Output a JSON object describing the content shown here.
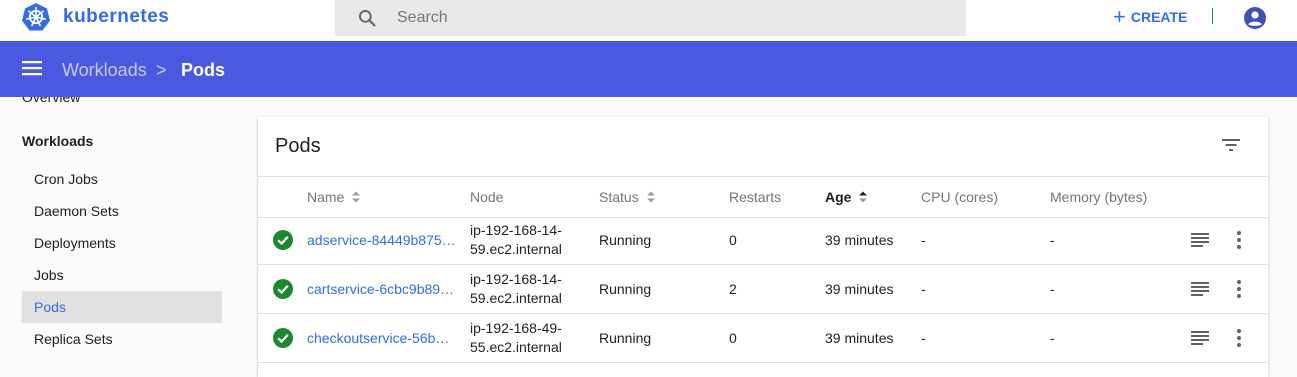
{
  "app": {
    "brand": "kubernetes",
    "accent": "#326de6",
    "nav_color": "#4a59e0"
  },
  "search": {
    "placeholder": "Search",
    "value": ""
  },
  "header": {
    "create_label": "CREATE"
  },
  "breadcrumb": {
    "parent": "Workloads",
    "separator": ">",
    "current": "Pods"
  },
  "sidebar": {
    "overview": "Overview",
    "section": "Workloads",
    "items": [
      {
        "label": "Cron Jobs"
      },
      {
        "label": "Daemon Sets"
      },
      {
        "label": "Deployments"
      },
      {
        "label": "Jobs"
      },
      {
        "label": "Pods",
        "active": true
      },
      {
        "label": "Replica Sets"
      }
    ]
  },
  "pods": {
    "title": "Pods",
    "columns": {
      "name": "Name",
      "node": "Node",
      "status": "Status",
      "restarts": "Restarts",
      "age": "Age",
      "cpu": "CPU (cores)",
      "memory": "Memory (bytes)"
    },
    "rows": [
      {
        "name": "adservice-84449b875…",
        "node": "ip-192-168-14-59.ec2.internal",
        "status": "Running",
        "restarts": "0",
        "age": "39 minutes",
        "cpu": "-",
        "memory": "-"
      },
      {
        "name": "cartservice-6cbc9b89…",
        "node": "ip-192-168-14-59.ec2.internal",
        "status": "Running",
        "restarts": "2",
        "age": "39 minutes",
        "cpu": "-",
        "memory": "-"
      },
      {
        "name": "checkoutservice-56b…",
        "node": "ip-192-168-49-55.ec2.internal",
        "status": "Running",
        "restarts": "0",
        "age": "39 minutes",
        "cpu": "-",
        "memory": "-"
      }
    ]
  },
  "icons": {
    "logo": "kubernetes-logo-icon",
    "search": "search-icon",
    "create": "plus-icon",
    "account": "account-circle-icon",
    "menu": "menu-icon",
    "filter": "filter-icon",
    "status": "check-circle-icon",
    "logs": "logs-icon",
    "more": "more-vert-icon"
  },
  "status_color": "#1b8a2f"
}
